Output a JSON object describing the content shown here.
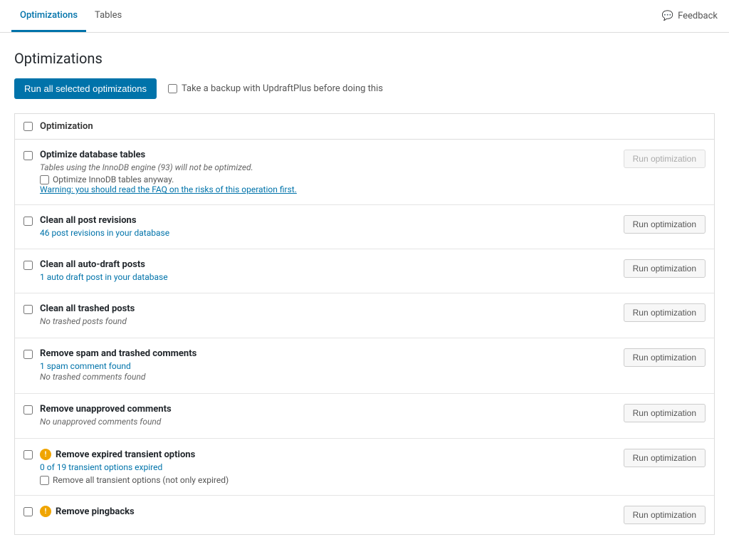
{
  "tabs": [
    {
      "id": "optimizations",
      "label": "Optimizations",
      "active": true
    },
    {
      "id": "tables",
      "label": "Tables",
      "active": false
    }
  ],
  "feedback": {
    "label": "Feedback",
    "icon": "💬"
  },
  "page": {
    "title": "Optimizations",
    "run_all_button": "Run all selected optimizations",
    "backup_checkbox_label": "Take a backup with UpdraftPlus before doing this"
  },
  "table": {
    "header": "Optimization",
    "rows": [
      {
        "id": "optimize-db",
        "title": "Optimize database tables",
        "desc": "Tables using the InnoDB engine (93) will not be optimized.",
        "sub_checkbox": "Optimize InnoDB tables anyway.",
        "warning": "Warning: you should read the FAQ on the risks of this operation first.",
        "link": null,
        "extra_desc": null,
        "button": "Run optimization",
        "button_disabled": true,
        "has_info_icon": false
      },
      {
        "id": "clean-revisions",
        "title": "Clean all post revisions",
        "desc": null,
        "sub_checkbox": null,
        "warning": null,
        "link": "46 post revisions in your database",
        "extra_desc": null,
        "button": "Run optimization",
        "button_disabled": false,
        "has_info_icon": false
      },
      {
        "id": "clean-autodraft",
        "title": "Clean all auto-draft posts",
        "desc": null,
        "sub_checkbox": null,
        "warning": null,
        "link": "1 auto draft post in your database",
        "extra_desc": null,
        "button": "Run optimization",
        "button_disabled": false,
        "has_info_icon": false
      },
      {
        "id": "clean-trashed",
        "title": "Clean all trashed posts",
        "desc": "No trashed posts found",
        "sub_checkbox": null,
        "warning": null,
        "link": null,
        "extra_desc": null,
        "button": "Run optimization",
        "button_disabled": false,
        "has_info_icon": false
      },
      {
        "id": "remove-spam",
        "title": "Remove spam and trashed comments",
        "desc": null,
        "sub_checkbox": null,
        "warning": null,
        "link": "1 spam comment found",
        "extra_desc": "No trashed comments found",
        "button": "Run optimization",
        "button_disabled": false,
        "has_info_icon": false
      },
      {
        "id": "remove-unapproved",
        "title": "Remove unapproved comments",
        "desc": "No unapproved comments found",
        "sub_checkbox": null,
        "warning": null,
        "link": null,
        "extra_desc": null,
        "button": "Run optimization",
        "button_disabled": false,
        "has_info_icon": false
      },
      {
        "id": "remove-transient",
        "title": "Remove expired transient options",
        "desc": null,
        "sub_checkbox": "Remove all transient options (not only expired)",
        "warning": null,
        "link": "0 of 19 transient options expired",
        "extra_desc": null,
        "button": "Run optimization",
        "button_disabled": false,
        "has_info_icon": true
      },
      {
        "id": "remove-pingbacks",
        "title": "Remove pingbacks",
        "desc": null,
        "sub_checkbox": null,
        "warning": null,
        "link": null,
        "extra_desc": null,
        "button": "Run optimization",
        "button_disabled": false,
        "has_info_icon": true
      }
    ]
  }
}
